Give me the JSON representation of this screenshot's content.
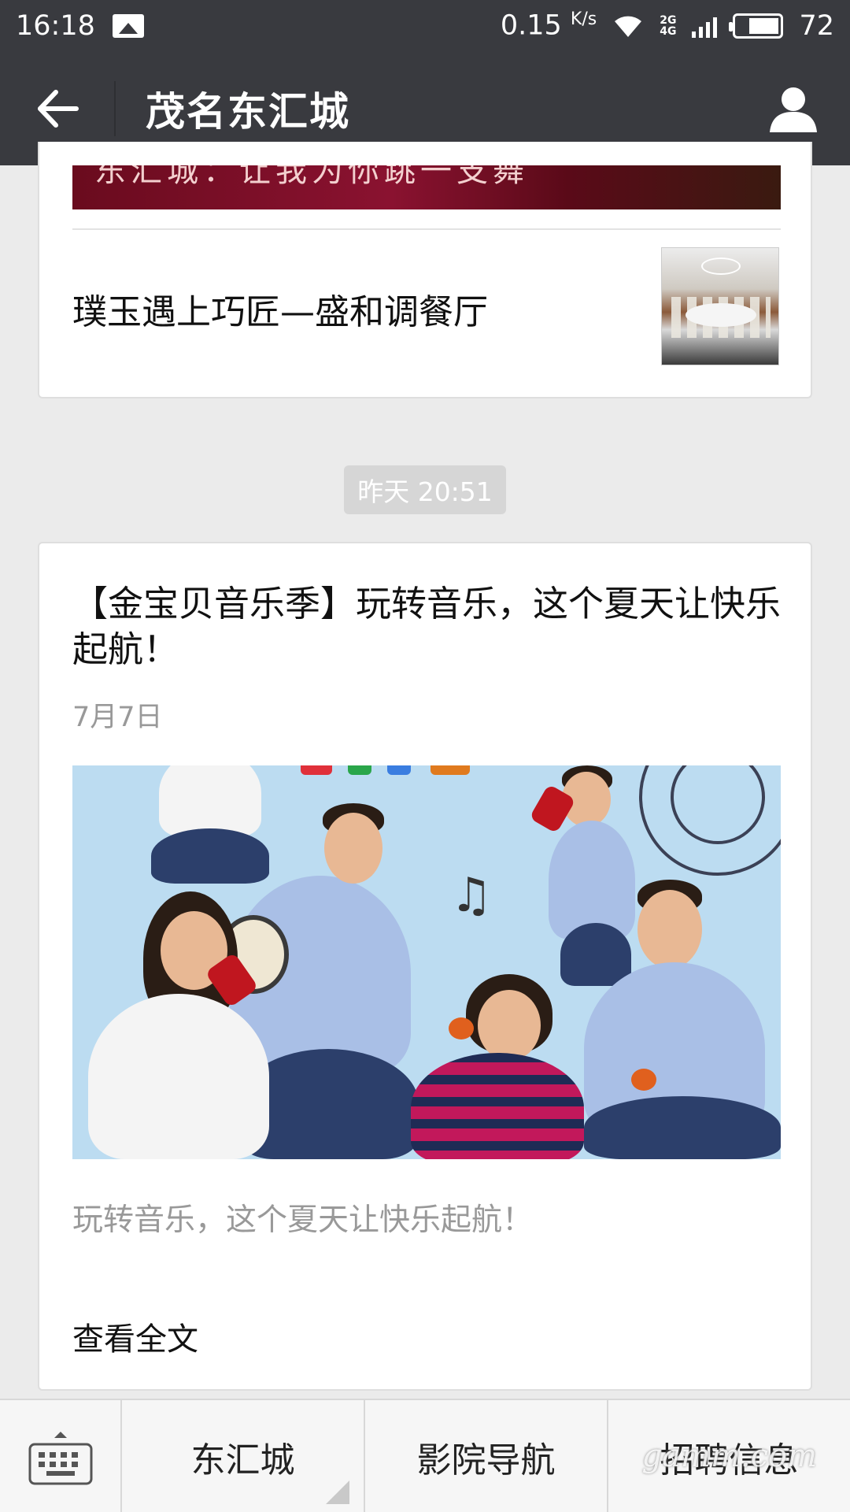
{
  "status_bar": {
    "time": "16:18",
    "net_speed": "0.15",
    "net_unit": "K/s",
    "network_top": "2G",
    "network_bottom": "4G",
    "battery": "72"
  },
  "header": {
    "title": "茂名东汇城"
  },
  "feed": {
    "prev_banner_caption": "东汇城：让我为你跳一支舞",
    "prev_sub_article_title": "璞玉遇上巧匠—盛和调餐厅",
    "timestamp": "昨天 20:51",
    "article": {
      "title": "【金宝贝音乐季】玩转音乐，这个夏天让快乐起航！",
      "date": "7月7日",
      "description": "玩转音乐，这个夏天让快乐起航！",
      "read_more": "查看全文"
    }
  },
  "bottom_menu": {
    "items": [
      "东汇城",
      "影院导航",
      "招聘信息"
    ]
  },
  "watermark": "gamm.com",
  "colors": {
    "header_bg": "#393a3f",
    "page_bg": "#ebebeb",
    "timestamp_bg": "#d6d6d6"
  }
}
